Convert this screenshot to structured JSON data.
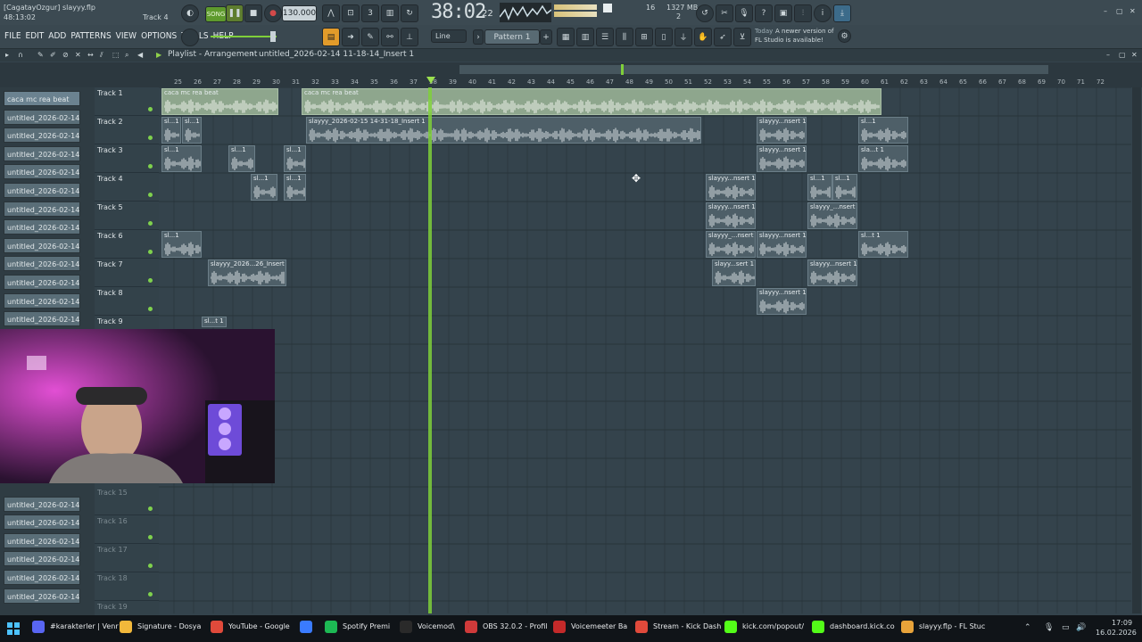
{
  "window": {
    "title_line1": "[CagatayOzgur] slayyy.flp",
    "title_line2": "48:13:02",
    "current_track": "Track 4",
    "win_min": "–",
    "win_max": "▢",
    "win_close": "✕"
  },
  "transport": {
    "mode_label": "SONG",
    "tempo": "130.000",
    "time_display": "38:02",
    "time_sub": "22",
    "cpu_voices": "16",
    "memory": "1327 MB",
    "cpu_sub": "2"
  },
  "menus": [
    "FILE",
    "EDIT",
    "ADD",
    "PATTERNS",
    "VIEW",
    "OPTIONS",
    "TOOLS",
    "HELP"
  ],
  "toolbar": {
    "snap_label": "Line",
    "pattern_label": "Pattern 1",
    "pattern_add": "+",
    "news_day": "Today",
    "news_text1": "A newer version of",
    "news_text2": "FL Studio is available!"
  },
  "playlist": {
    "breadcrumb1": "Playlist - Arrangement",
    "breadcrumb2": "untitled_2026-02-14 11-18-14_Insert 1",
    "sep": "›",
    "ruler": [
      "25",
      "26",
      "27",
      "28",
      "29",
      "30",
      "31",
      "32",
      "33",
      "34",
      "35",
      "36",
      "37",
      "38",
      "39",
      "40",
      "41",
      "42",
      "43",
      "44",
      "45",
      "46",
      "47",
      "48",
      "49",
      "50",
      "51",
      "52",
      "53",
      "54",
      "55",
      "56",
      "57",
      "58",
      "59",
      "60",
      "61",
      "62",
      "63",
      "64",
      "65",
      "66",
      "67",
      "68",
      "69",
      "70",
      "71",
      "72"
    ]
  },
  "patterns": [
    "caca mc rea beat",
    "untitled_2026-02-14 11-...",
    "untitled_2026-02-14 11-...",
    "untitled_2026-02-14 11-...",
    "untitled_2026-02-14 11-...",
    "untitled_2026-02-14 11-...",
    "untitled_2026-02-14 11-...",
    "untitled_2026-02-14 11-...",
    "untitled_2026-02-14 11-...",
    "untitled_2026-02-14 11-...",
    "untitled_2026-02-14 11-...",
    "untitled_2026-02-14 11-...",
    "untitled_2026-02-14 11-...",
    "untitled_2026-02-14 11-...",
    "untitled_2026-02-14 11-...",
    "untitled_2026-02-14 11-...",
    "untitled_2026-02-14 11-...",
    "untitled_2026-02-14 11-...",
    "untitled_2026-02-14 11-...",
    "untitled_2026-02-14 11-..."
  ],
  "tracks": [
    "Track 1",
    "Track 2",
    "Track 3",
    "Track 4",
    "Track 5",
    "Track 6",
    "Track 7",
    "Track 8",
    "Track 9",
    "Track 15",
    "Track 16",
    "Track 17",
    "Track 18",
    "Track 19"
  ],
  "clips": {
    "t1a": "caca mc rea beat",
    "t1b": "caca mc rea beat",
    "t2main": "slayyy_2026-02-15 14-31-18_Insert 1",
    "t2r1": "slayyy...nsert 1",
    "t2r2": "sl...1",
    "t3r1": "slayyy...nsert 1",
    "t3r2": "sla...t 1",
    "t4r1": "slayyy...nsert 1",
    "t4r2": "sl...1",
    "t4r3": "sl...1",
    "t5r1": "slayyy...nsert 1",
    "t5r2": "slayyy_...nsert 1",
    "t6r1": "slayyy_...nsert 1",
    "t6r2": "slayyy...nsert 1",
    "t6r3": "sl...t 1",
    "t7a": "slayyy_2026...26_Insert 1",
    "t7r1": "slayy...sert 1",
    "t7r2": "slayyy...nsert 1",
    "t8r1": "slayyy...nsert 1",
    "t9a": "sl...t 1",
    "small1": "sl...1",
    "small2": "sl...1"
  },
  "taskbar": {
    "items": [
      "#karakterler | Venr",
      "Signature - Dosya",
      "YouTube - Google",
      "",
      "Spotify Premi",
      "Voicemod\\",
      "OBS 32.0.2 - Profil",
      "Voicemeeter Ba",
      "Stream - Kick Dash",
      "kick.com/popout/",
      "dashboard.kick.co",
      "slayyy.flp - FL Stuc"
    ],
    "time": "17:09",
    "date": "16.02.2026"
  }
}
